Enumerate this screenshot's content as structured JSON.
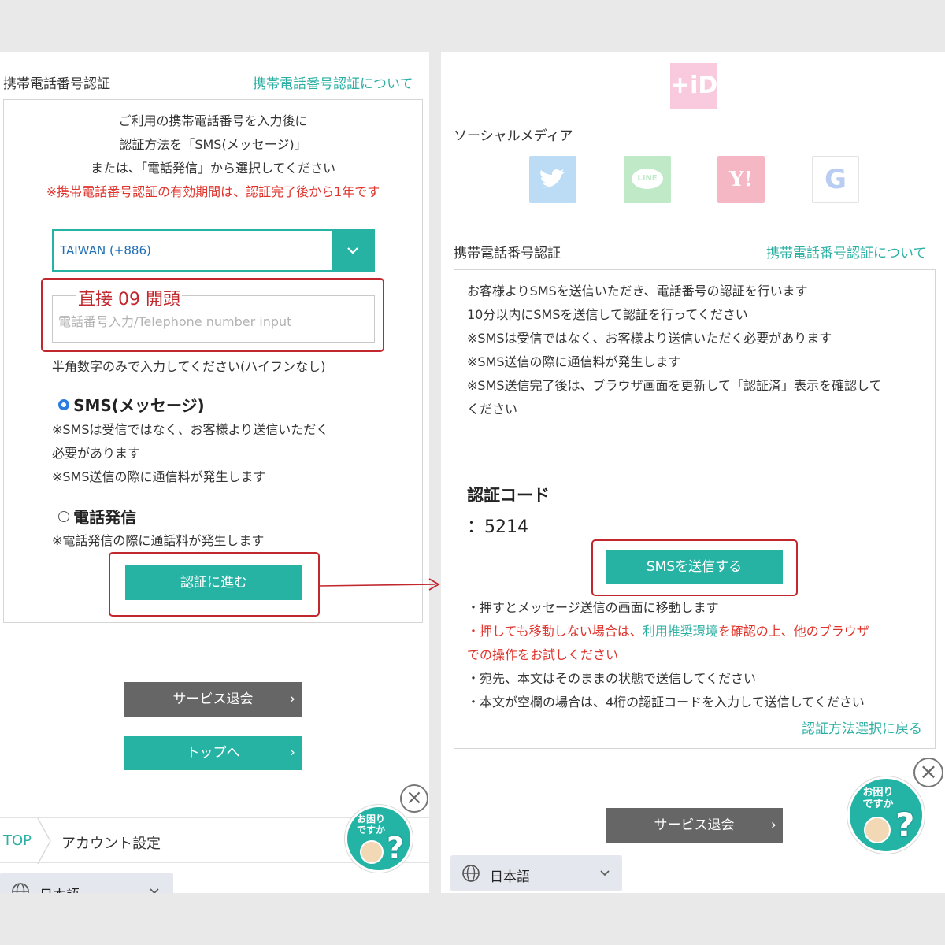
{
  "left": {
    "section_title": "携帯電話番号認証",
    "section_link": "携帯電話番号認証について",
    "intro_lines": [
      "ご利用の携帯電話番号を入力後に",
      "認証方法を「SMS(メッセージ)」",
      "または、「電話発信」から選択してください"
    ],
    "validity_notice": "※携帯電話番号認証の有効期間は、認証完了後から1年です",
    "country_select": "TAIWAN (+886)",
    "annotation": "直接 09 開頭",
    "phone_placeholder": "電話番号入力/Telephone number input",
    "input_hint": "半角数字のみで入力してください(ハイフンなし)",
    "option_sms": {
      "label": "SMS(メッセージ)",
      "notes": [
        "※SMSは受信ではなく、お客様より送信いただく",
        "必要があります",
        "※SMS送信の際に通信料が発生します"
      ]
    },
    "option_call": {
      "label": "電話発信",
      "notes": [
        "※電話発信の際に通話料が発生します"
      ]
    },
    "proceed_button": "認証に進む",
    "withdraw_button": "サービス退会",
    "top_button": "トップへ",
    "breadcrumb": [
      "TOP",
      "アカウント設定"
    ],
    "language": "日本語",
    "help_text": [
      "お困り",
      "ですか"
    ]
  },
  "right": {
    "logo_text": "+iD",
    "social_title": "ソーシャルメディア",
    "social_labels": [
      "LINE",
      "Y!",
      "G"
    ],
    "section_title": "携帯電話番号認証",
    "section_link": "携帯電話番号認証について",
    "instructions": [
      "お客様よりSMSを送信いただき、電話番号の認証を行います",
      "10分以内にSMSを送信して認証を行ってください",
      "※SMSは受信ではなく、お客様より送信いただく必要があります",
      "※SMS送信の際に通信料が発生します",
      "※SMS送信完了後は、ブラウザ画面を更新して「認証済」表示を確認して",
      "ください"
    ],
    "code_label": "認証コード",
    "code_value": "：5214",
    "send_button": "SMSを送信する",
    "note_1": "・押すとメッセージ送信の画面に移動します",
    "note_2_pre": "・押しても移動しない場合は、",
    "note_2_link": "利用推奨環境",
    "note_2_post": "を確認の上、他のブラウザ",
    "note_2_cont": "での操作をお試しください",
    "note_3": "・宛先、本文はそのままの状態で送信してください",
    "note_4": "・本文が空欄の場合は、4桁の認証コードを入力して送信してください",
    "back_link": "認証方法選択に戻る",
    "withdraw_button": "サービス退会",
    "language": "日本語",
    "help_text": [
      "お困り",
      "ですか"
    ]
  },
  "colors": {
    "teal": "#27b3a4",
    "red": "#e0332b",
    "annotation_red": "#c1272d",
    "gray_button": "#666666",
    "logo_pink": "#f9c9dd"
  }
}
